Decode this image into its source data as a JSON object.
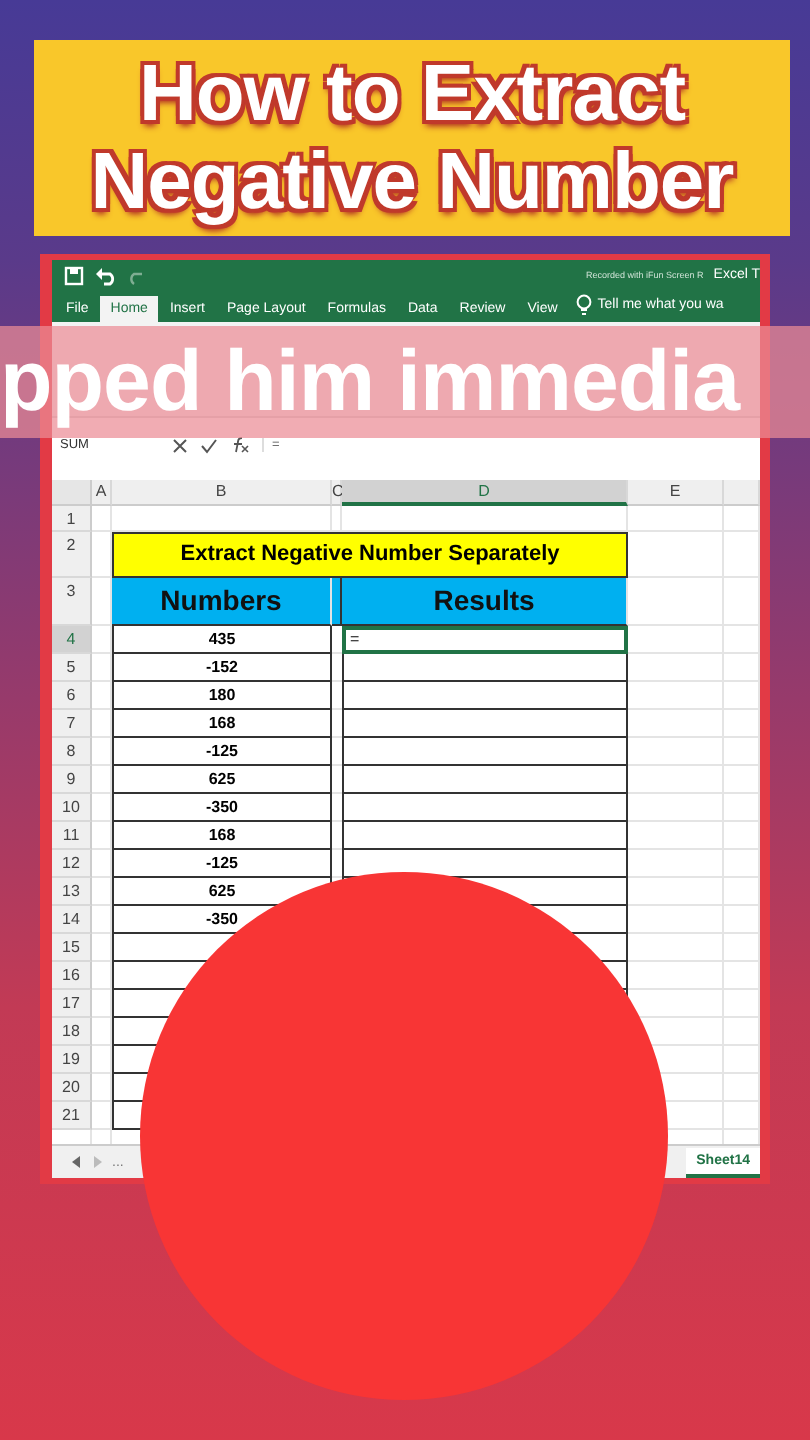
{
  "headline": [
    "How to Extract",
    "Negative Number"
  ],
  "caption": "pped him immedia",
  "excel": {
    "title_bar": {
      "recorder_note": "Recorded with iFun Screen R",
      "title": "Excel T"
    },
    "tabs": [
      {
        "label": "File",
        "selected": false
      },
      {
        "label": "Home",
        "selected": true
      },
      {
        "label": "Insert",
        "selected": false
      },
      {
        "label": "Page Layout",
        "selected": false
      },
      {
        "label": "Formulas",
        "selected": false
      },
      {
        "label": "Data",
        "selected": false
      },
      {
        "label": "Review",
        "selected": false
      },
      {
        "label": "View",
        "selected": false
      }
    ],
    "tell_me": "Tell me what you wa",
    "name_box": "SUM",
    "formula": "=",
    "columns": [
      {
        "label": "A",
        "selected": false
      },
      {
        "label": "B",
        "selected": false
      },
      {
        "label": "C",
        "selected": false
      },
      {
        "label": "D",
        "selected": true
      },
      {
        "label": "E",
        "selected": false
      }
    ],
    "row_numbers": [
      "1",
      "2",
      "3",
      "4",
      "5",
      "6",
      "7",
      "8",
      "9",
      "10",
      "11",
      "12",
      "13",
      "14",
      "15",
      "16",
      "17",
      "18",
      "19",
      "20",
      "21"
    ],
    "table_title": "Extract Negative Number Separately",
    "headers": [
      "Numbers",
      "Results"
    ],
    "data": [
      {
        "number": "435",
        "result": "=",
        "active": true
      },
      {
        "number": "-152",
        "active": false
      },
      {
        "number": "180",
        "active": false
      },
      {
        "number": "168",
        "active": false
      },
      {
        "number": "-125",
        "active": false
      },
      {
        "number": "625",
        "active": false
      },
      {
        "number": "-350",
        "active": false
      },
      {
        "number": "168",
        "active": false
      },
      {
        "number": "-125",
        "active": false
      },
      {
        "number": "625",
        "active": false
      },
      {
        "number": "-350",
        "active": false
      }
    ],
    "sheet_tabs": {
      "more": "...",
      "sheets": [
        {
          "label": "Sheet14",
          "selected": true
        }
      ]
    }
  }
}
